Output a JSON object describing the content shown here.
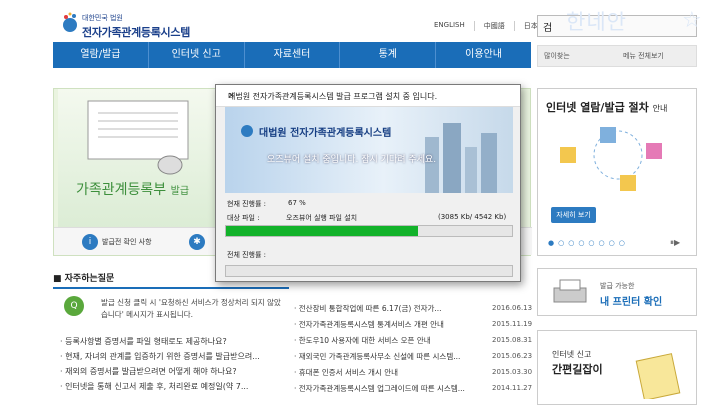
{
  "header": {
    "logo_sub": "대한민국 법원",
    "logo_main": "전자가족관계등록시스템",
    "languages": [
      "ENGLISH",
      "中國語",
      "日本語"
    ],
    "search_value": "검",
    "watermark": "한네안",
    "right_tabs": [
      "많이찾는",
      "메뉴 전체보기"
    ]
  },
  "nav": [
    "열람/발급",
    "인터넷 신고",
    "자료센터",
    "통계",
    "이용안내"
  ],
  "banner": {
    "title": "가족관계등록부",
    "title_suffix": "발급",
    "bottom_item": "발급전 확인 사항"
  },
  "faq": {
    "header": "자주하는질문",
    "question_preview": "발급 신청 클릭 시 '요청하신 서비스가 정상처리 되지 않았습니다' 메시지가 표시됩니다.",
    "items": [
      "등록사항별 증명서를 파일 형태로도 제공하나요?",
      "현재, 자녀의 관계를 입증하기 위한 증명서를 발급받으려...",
      "재외의 증명서를 발급받으려면 어떻게 해야 하나요?",
      "인터넷을 통해 신고서 제출 후, 처리완료 예정일(약 7..."
    ]
  },
  "news": [
    {
      "title": "전산장비 통합작업에 따른 6.17(금) 전자가...",
      "date": "2016.06.13"
    },
    {
      "title": "전자가족관계등록시스템 통계서비스 개편 안내",
      "date": "2015.11.19"
    },
    {
      "title": "한도우10 사용자에 대한 서비스 오픈 안내",
      "date": "2015.08.31"
    },
    {
      "title": "재외국민 가족관계등록사무소 신설에 따른 시스템...",
      "date": "2015.06.23"
    },
    {
      "title": "휴대폰 인증서 서비스 개시 안내",
      "date": "2015.03.30"
    },
    {
      "title": "전자가족관계등록시스템 업그레이드에 따른 시스템...",
      "date": "2014.11.27"
    }
  ],
  "right_panel": {
    "title": "인터넷 열람/발급 절차",
    "title_suffix": "안내",
    "detail_button": "자세히 보기"
  },
  "print_box": {
    "line1": "발급 가능한",
    "line2": "내 프린터 확인"
  },
  "guide_box": {
    "line1": "인터넷 신고",
    "line2": "간편길잡이"
  },
  "dialog": {
    "title": "대법원 전자가족관계등록시스템 발급 프로그램 설치 중 입니다.",
    "banner_name": "대법원 전자가족관계등록시스템",
    "banner_msg": "오즈뷰어 설치 중입니다. 잠시 기다려 주세요.",
    "progress_label": "현재 진행률 :",
    "progress_value": "67 %",
    "progress_fraction": 0.67,
    "target_label": "대상 파일 :",
    "target_name": "오즈뷰어 실행 파일 설치",
    "size": "(3085 Kb/ 4542 Kb)",
    "total_label": "전체 진행률 :",
    "total_fraction": 0.0
  },
  "colors": {
    "nav": "#1a6db8",
    "progress": "#12b22a",
    "banner_green": "#3d8f3c"
  }
}
